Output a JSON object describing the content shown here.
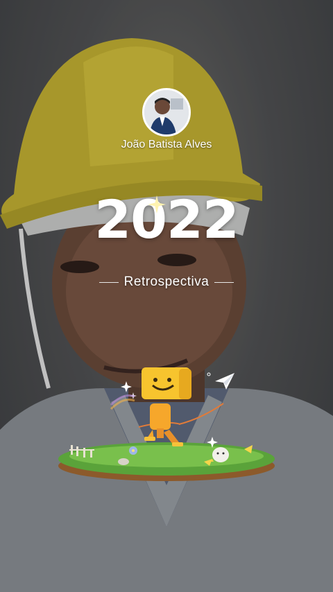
{
  "profile": {
    "name": "João Batista Alves",
    "avatar_icon": "user-avatar"
  },
  "story": {
    "year": "2022",
    "subtitle": "Retrospectiva"
  },
  "illustration": {
    "icons": [
      "mascot-figure",
      "paper-plane-icon",
      "grass-island",
      "bird-icon",
      "flower-icon",
      "sparkle-icon"
    ]
  }
}
